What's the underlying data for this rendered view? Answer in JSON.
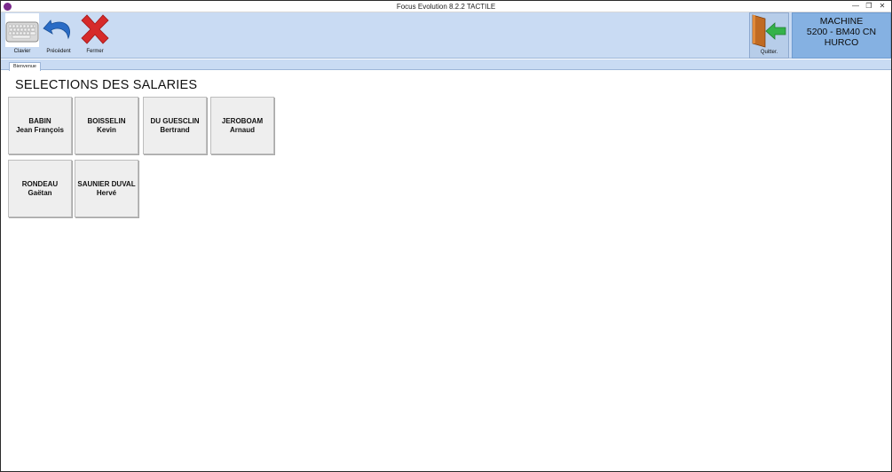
{
  "window": {
    "title": "Focus Evolution 8.2.2  TACTILE",
    "controls": {
      "minimize": "—",
      "maximize": "❐",
      "close": "✕"
    }
  },
  "toolbar": {
    "clavier_label": "Clavier",
    "precedent_label": "Précédent",
    "fermer_label": "Fermer",
    "icons": {
      "clavier": "keyboard-icon",
      "precedent": "undo-arrow-icon",
      "fermer": "red-x-icon",
      "quitter": "exit-door-icon"
    }
  },
  "quit": {
    "label": "Quitter."
  },
  "machine": {
    "line1": "MACHINE",
    "line2": "5200 - BM40 CN",
    "line3": "HURCO"
  },
  "tabs": [
    {
      "label": "Bienvenue"
    }
  ],
  "main": {
    "heading": "SELECTIONS DES SALARIES",
    "employees": [
      {
        "last": "BABIN",
        "first": "Jean François"
      },
      {
        "last": "BOISSELIN",
        "first": "Kevin"
      },
      {
        "last": "DU GUESCLIN",
        "first": "Bertrand"
      },
      {
        "last": "JEROBOAM",
        "first": "Arnaud"
      },
      {
        "last": "RONDEAU",
        "first": "Gaëtan"
      },
      {
        "last": "SAUNIER DUVAL",
        "first": "Hervé"
      }
    ]
  },
  "colors": {
    "ribbon": "#c9dbf3",
    "machine_panel": "#85b1e2",
    "button_face": "#eeeeee"
  }
}
